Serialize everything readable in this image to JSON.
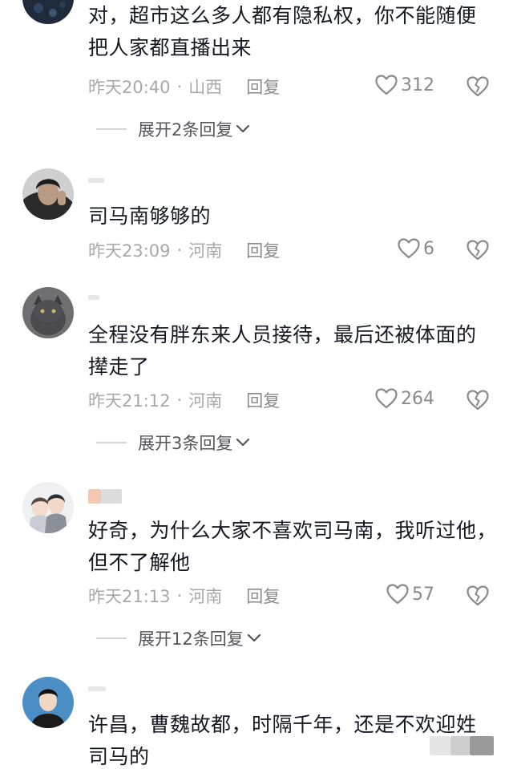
{
  "comments": [
    {
      "text_lines": [
        "对，超市这么多人都有隐私权，你不能随便",
        "把人家都直播出来"
      ],
      "time": "昨天20:40",
      "location": "山西",
      "reply_label": "回复",
      "likes": "312",
      "expand_label": "展开2条回复"
    },
    {
      "text_lines": [
        "司马南够够的"
      ],
      "time": "昨天23:09",
      "location": "河南",
      "reply_label": "回复",
      "likes": "6"
    },
    {
      "text_lines": [
        "全程没有胖东来人员接待，最后还被体面的",
        "撵走了"
      ],
      "time": "昨天21:12",
      "location": "河南",
      "reply_label": "回复",
      "likes": "264",
      "expand_label": "展开3条回复"
    },
    {
      "text_lines": [
        "好奇，为什么大家不喜欢司马南，我听过他，",
        "但不了解他"
      ],
      "time": "昨天21:13",
      "location": "河南",
      "reply_label": "回复",
      "likes": "57",
      "expand_label": "展开12条回复"
    },
    {
      "text_lines": [
        "许昌，曹魏故都，时隔千年，还是不欢迎姓",
        "司马的"
      ]
    }
  ],
  "icons": {
    "like": "heart-outline-icon",
    "dislike": "broken-heart-icon",
    "expand": "chevron-down-icon"
  },
  "colors": {
    "text": "#161823",
    "meta": "#a8a8ad",
    "reply": "#8a8a8f"
  }
}
